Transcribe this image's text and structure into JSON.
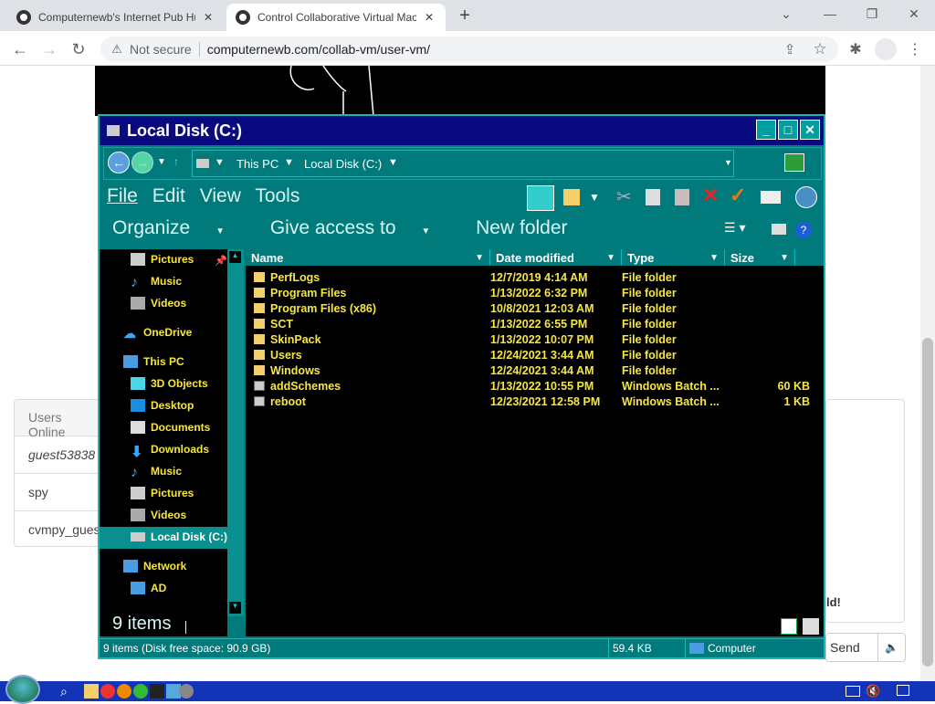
{
  "browser": {
    "tabs": [
      {
        "title": "Computernewb's Internet Pub Hub",
        "active": false
      },
      {
        "title": "Control Collaborative Virtual Machine",
        "active": true
      }
    ],
    "security_label": "Not secure",
    "url": "computernewb.com/collab-vm/user-vm/"
  },
  "sidebar": {
    "users_header": "Users Online",
    "users": [
      "guest53838",
      "spy",
      "cvmpy_guest"
    ]
  },
  "chat": {
    "visible_fragment": "ld!",
    "send_label": "Send"
  },
  "explorer": {
    "title": "Local Disk (C:)",
    "address": [
      "This PC",
      "Local Disk (C:)"
    ],
    "menu": [
      "File",
      "Edit",
      "View",
      "Tools"
    ],
    "commands": [
      "Organize",
      "Give access to",
      "New folder"
    ],
    "nav": [
      {
        "label": "Pictures",
        "icon": "pictures-icon"
      },
      {
        "label": "Music",
        "icon": "music-icon"
      },
      {
        "label": "Videos",
        "icon": "videos-icon"
      },
      {
        "label": "OneDrive",
        "icon": "cloud-icon"
      },
      {
        "label": "This PC",
        "icon": "computer-icon"
      },
      {
        "label": "3D Objects",
        "icon": "cube-icon"
      },
      {
        "label": "Desktop",
        "icon": "desktop-icon"
      },
      {
        "label": "Documents",
        "icon": "documents-icon"
      },
      {
        "label": "Downloads",
        "icon": "download-icon"
      },
      {
        "label": "Music",
        "icon": "music-icon"
      },
      {
        "label": "Pictures",
        "icon": "pictures-icon"
      },
      {
        "label": "Videos",
        "icon": "videos-icon"
      },
      {
        "label": "Local Disk (C:)",
        "icon": "drive-icon"
      },
      {
        "label": "Network",
        "icon": "network-icon"
      },
      {
        "label": "AD",
        "icon": "computer-icon"
      }
    ],
    "columns": [
      "Name",
      "Date modified",
      "Type",
      "Size"
    ],
    "files": [
      {
        "name": "PerfLogs",
        "date": "12/7/2019 4:14 AM",
        "type": "File folder",
        "size": "",
        "kind": "folder"
      },
      {
        "name": "Program Files",
        "date": "1/13/2022 6:32 PM",
        "type": "File folder",
        "size": "",
        "kind": "folder"
      },
      {
        "name": "Program Files (x86)",
        "date": "10/8/2021 12:03 AM",
        "type": "File folder",
        "size": "",
        "kind": "folder"
      },
      {
        "name": "SCT",
        "date": "1/13/2022 6:55 PM",
        "type": "File folder",
        "size": "",
        "kind": "folder"
      },
      {
        "name": "SkinPack",
        "date": "1/13/2022 10:07 PM",
        "type": "File folder",
        "size": "",
        "kind": "folder"
      },
      {
        "name": "Users",
        "date": "12/24/2021 3:44 AM",
        "type": "File folder",
        "size": "",
        "kind": "folder"
      },
      {
        "name": "Windows",
        "date": "12/24/2021 3:44 AM",
        "type": "File folder",
        "size": "",
        "kind": "folder"
      },
      {
        "name": "addSchemes",
        "date": "1/13/2022 10:55 PM",
        "type": "Windows Batch ...",
        "size": "60 KB",
        "kind": "batch"
      },
      {
        "name": "reboot",
        "date": "12/23/2021 12:58 PM",
        "type": "Windows Batch ...",
        "size": "1 KB",
        "kind": "batch"
      }
    ],
    "item_count": "9 items",
    "status": {
      "summary": "9 items (Disk free space: 90.9 GB)",
      "size": "59.4 KB",
      "location": "Computer"
    }
  },
  "colors": {
    "window_bg": "#007a7a",
    "title_bar": "#0a0a80",
    "file_text": "#f5e642",
    "taskbar": "#1434b8"
  }
}
